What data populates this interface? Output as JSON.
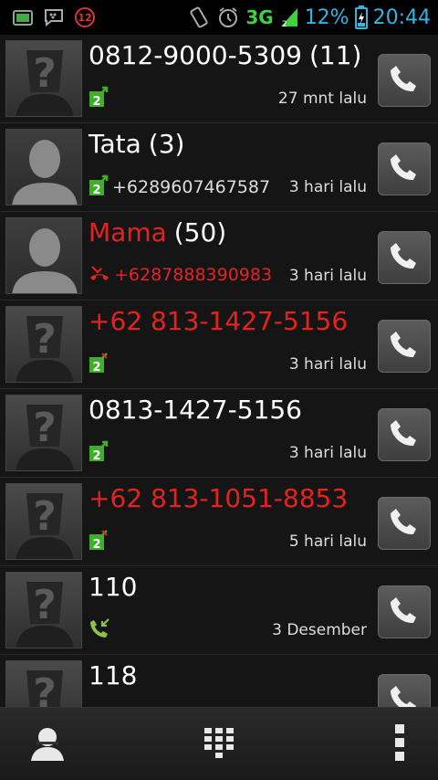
{
  "status_bar": {
    "notification_badge": "12",
    "network": "3G",
    "battery": "12%",
    "time": "20:44"
  },
  "call_log": [
    {
      "name": "0812-9000-5309",
      "count": "(11)",
      "name_red": false,
      "number": "",
      "number_red": false,
      "icon": "sim2-outgoing-icon",
      "time": "27 mnt lalu",
      "avatar": "unknown"
    },
    {
      "name": "Tata",
      "count": "(3)",
      "name_red": false,
      "number": "+6289607467587",
      "number_red": false,
      "icon": "sim2-outgoing-icon",
      "time": "3 hari lalu",
      "avatar": "contact"
    },
    {
      "name": "Mama",
      "count": "(50)",
      "name_red": true,
      "number": "+6287888390983",
      "number_red": true,
      "icon": "missed-call-icon",
      "time": "3 hari lalu",
      "avatar": "contact"
    },
    {
      "name": "+62 813-1427-5156",
      "count": "",
      "name_red": true,
      "number": "",
      "number_red": false,
      "icon": "sim2-missed-icon",
      "time": "3 hari lalu",
      "avatar": "unknown"
    },
    {
      "name": "0813-1427-5156",
      "count": "",
      "name_red": false,
      "number": "",
      "number_red": false,
      "icon": "sim2-outgoing-icon",
      "time": "3 hari lalu",
      "avatar": "unknown"
    },
    {
      "name": "+62 813-1051-8853",
      "count": "",
      "name_red": true,
      "number": "",
      "number_red": false,
      "icon": "sim2-missed-icon",
      "time": "5 hari lalu",
      "avatar": "unknown"
    },
    {
      "name": "110",
      "count": "",
      "name_red": false,
      "number": "",
      "number_red": false,
      "icon": "incoming-call-icon",
      "time": "3 Desember",
      "avatar": "unknown"
    },
    {
      "name": "118",
      "count": "",
      "name_red": false,
      "number": "",
      "number_red": false,
      "icon": "",
      "time": "",
      "avatar": "unknown"
    }
  ],
  "colors": {
    "missed": "#e52222",
    "accent": "#33b5e5",
    "sim_green": "#3fae2a"
  }
}
